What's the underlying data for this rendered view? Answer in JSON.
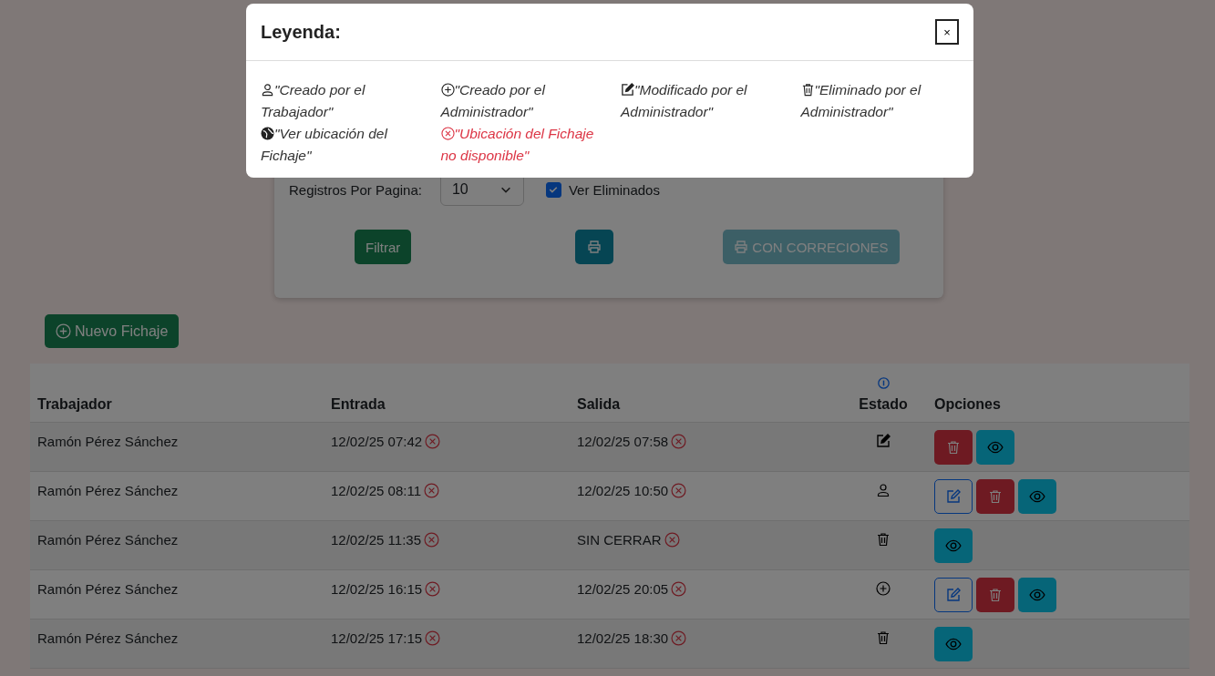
{
  "filters": {
    "per_page_label": "Registros Por Pagina:",
    "per_page_value": "10",
    "show_deleted": {
      "label": "Ver Eliminados",
      "checked": true
    },
    "buttons": [
      {
        "kind": "filter",
        "label": "Filtrar",
        "disabled": false
      },
      {
        "kind": "print",
        "disabled": false
      },
      {
        "kind": "print-corrections",
        "label": "CON CORRECIONES",
        "disabled": true
      }
    ]
  },
  "new_button": {
    "label": "Nuevo Fichaje"
  },
  "table": {
    "columns": [
      "Trabajador",
      "Entrada",
      "Salida",
      "Estado",
      "Opciones"
    ],
    "rows": [
      {
        "worker": "Ramón Pérez Sánchez",
        "entrada": {
          "text": "12/02/25 07:42",
          "located": false
        },
        "salida": {
          "text": "12/02/25 07:58",
          "located": false
        },
        "estado": {
          "kind": "modified"
        },
        "actions": [
          {
            "kind": "delete"
          },
          {
            "kind": "view"
          }
        ]
      },
      {
        "worker": "Ramón Pérez Sánchez",
        "entrada": {
          "text": "12/02/25 08:11",
          "located": false
        },
        "salida": {
          "text": "12/02/25 10:50",
          "located": false
        },
        "estado": {
          "kind": "worker"
        },
        "actions": [
          {
            "kind": "edit"
          },
          {
            "kind": "delete"
          },
          {
            "kind": "view"
          }
        ]
      },
      {
        "worker": "Ramón Pérez Sánchez",
        "entrada": {
          "text": "12/02/25 11:35",
          "located": false
        },
        "salida": {
          "text": "SIN CERRAR",
          "located": false
        },
        "estado": {
          "kind": "deleted"
        },
        "actions": [
          {
            "kind": "view"
          }
        ]
      },
      {
        "worker": "Ramón Pérez Sánchez",
        "entrada": {
          "text": "12/02/25 16:15",
          "located": false
        },
        "salida": {
          "text": "12/02/25 20:05",
          "located": false
        },
        "estado": {
          "kind": "admin"
        },
        "actions": [
          {
            "kind": "edit"
          },
          {
            "kind": "delete"
          },
          {
            "kind": "view"
          }
        ]
      },
      {
        "worker": "Ramón Pérez Sánchez",
        "entrada": {
          "text": "12/02/25 17:15",
          "located": false
        },
        "salida": {
          "text": "12/02/25 18:30",
          "located": false
        },
        "estado": {
          "kind": "deleted"
        },
        "actions": [
          {
            "kind": "view"
          }
        ]
      }
    ]
  },
  "modal": {
    "title": "Leyenda:",
    "close": "×",
    "items": [
      {
        "kind": "worker",
        "text": "\"Creado por el Trabajador\""
      },
      {
        "kind": "admin",
        "text": "\"Creado por el Administrador\""
      },
      {
        "kind": "modified",
        "text": "\"Modificado por el Administrador\""
      },
      {
        "kind": "deleted",
        "text": "\"Eliminado por el Administrador\""
      },
      {
        "kind": "location",
        "text": "\"Ver ubicación del Fichaje\""
      },
      {
        "kind": "no-location",
        "text": "\"Ubicación del Fichaje no disponible\""
      }
    ]
  }
}
